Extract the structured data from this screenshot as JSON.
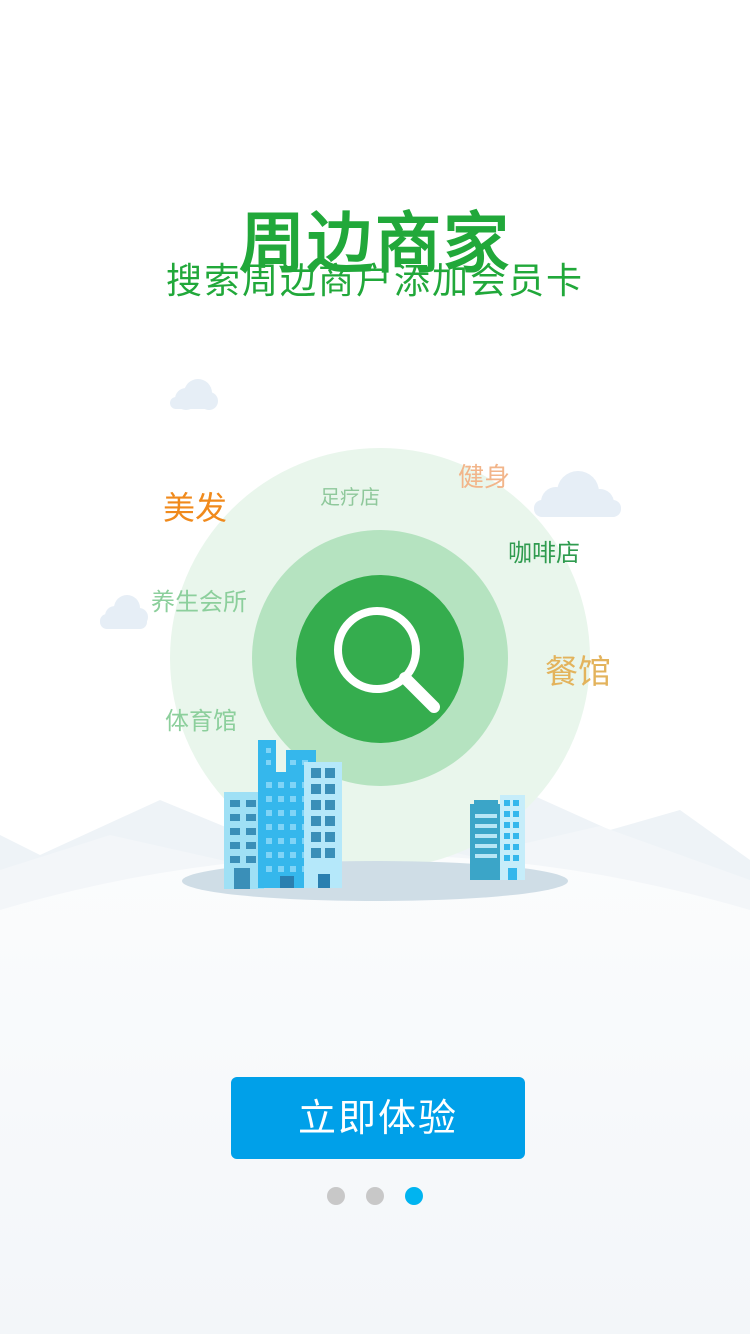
{
  "header": {
    "title": "周边商家",
    "subtitle": "搜索周边商户添加会员卡"
  },
  "tags": [
    {
      "id": "meifa",
      "label": "美发",
      "color": "#f08a1c"
    },
    {
      "id": "zuliaodian",
      "label": "足疗店",
      "color": "#8fc89b"
    },
    {
      "id": "jianshen",
      "label": "健身",
      "color": "#f2b58a"
    },
    {
      "id": "kafeidian",
      "label": "咖啡店",
      "color": "#2f9b4f"
    },
    {
      "id": "yangshenghuisuo",
      "label": "养生会所",
      "color": "#8ccf9c"
    },
    {
      "id": "canguan",
      "label": "餐馆",
      "color": "#e3b35c"
    },
    {
      "id": "tiyuguan",
      "label": "体育馆",
      "color": "#8ccf9c"
    }
  ],
  "actions": {
    "start_label": "立即体验"
  },
  "pager": {
    "total": 3,
    "active": 3
  },
  "colors": {
    "title": "#21a83a",
    "subtitle": "#21a83a",
    "button": "#00a0e9",
    "dot_active": "#00b4f0",
    "dot_inactive": "#c8c8c8",
    "search_circle": "#35ad4e",
    "middle_ring": "#b5e3c0",
    "outer_ring": "#e9f6ec"
  },
  "icons": {
    "search": "search-icon",
    "cloud": "cloud-icon"
  }
}
